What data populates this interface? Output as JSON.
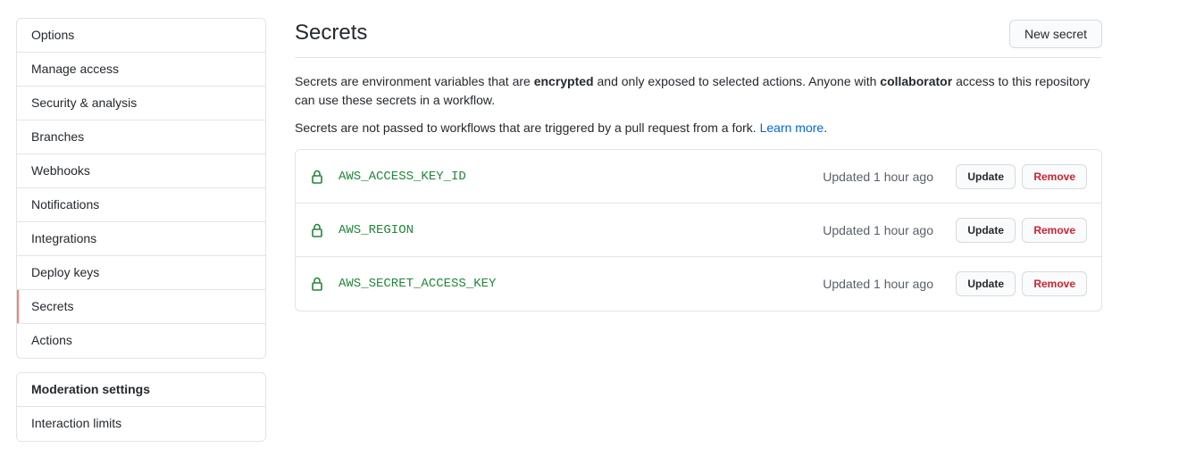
{
  "sidebar": {
    "items": [
      {
        "label": "Options"
      },
      {
        "label": "Manage access"
      },
      {
        "label": "Security & analysis"
      },
      {
        "label": "Branches"
      },
      {
        "label": "Webhooks"
      },
      {
        "label": "Notifications"
      },
      {
        "label": "Integrations"
      },
      {
        "label": "Deploy keys"
      },
      {
        "label": "Secrets"
      },
      {
        "label": "Actions"
      }
    ],
    "selected": "Secrets",
    "moderation": {
      "heading": "Moderation settings",
      "items": [
        {
          "label": "Interaction limits"
        }
      ]
    }
  },
  "main": {
    "title": "Secrets",
    "new_secret_label": "New secret",
    "description": {
      "part1": "Secrets are environment variables that are ",
      "bold1": "encrypted",
      "part2": " and only exposed to selected actions. Anyone with ",
      "bold2": "collaborator",
      "part3": " access to this repository can use these secrets in a workflow."
    },
    "fork_note": "Secrets are not passed to workflows that are triggered by a pull request from a fork. ",
    "learn_more_label": "Learn more",
    "learn_more_period": ".",
    "secrets": [
      {
        "name": "AWS_ACCESS_KEY_ID",
        "updated": "Updated 1 hour ago",
        "update_label": "Update",
        "remove_label": "Remove"
      },
      {
        "name": "AWS_REGION",
        "updated": "Updated 1 hour ago",
        "update_label": "Update",
        "remove_label": "Remove"
      },
      {
        "name": "AWS_SECRET_ACCESS_KEY",
        "updated": "Updated 1 hour ago",
        "update_label": "Update",
        "remove_label": "Remove"
      }
    ]
  },
  "colors": {
    "selected_accent": "#f9826c",
    "secret_name": "#22863a",
    "remove_text": "#cb2431",
    "link": "#0366d6"
  },
  "icons": {
    "secret_icon": "lock-icon"
  }
}
